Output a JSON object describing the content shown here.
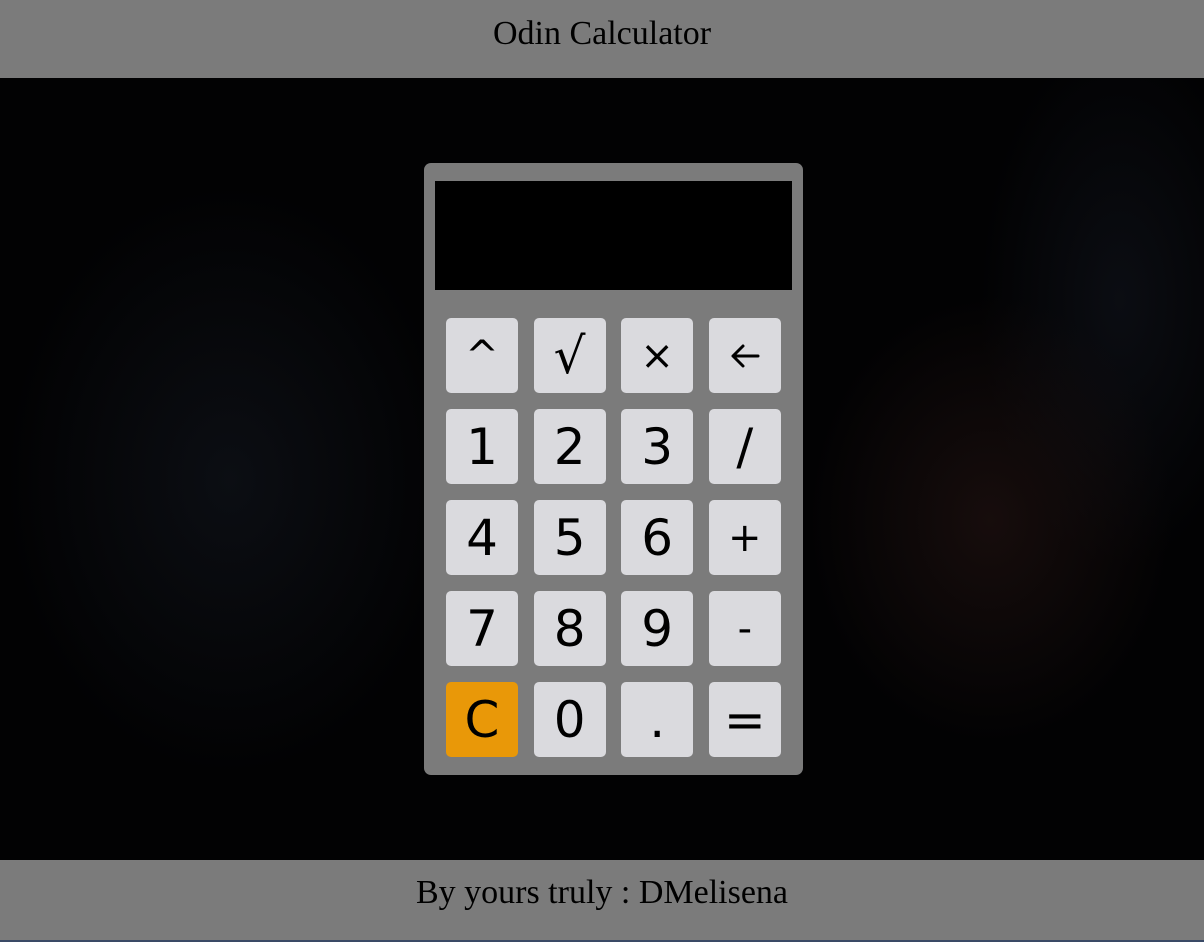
{
  "header": {
    "title": "Odin Calculator"
  },
  "display": {
    "value": ""
  },
  "keypad": {
    "keys": [
      {
        "label": "^",
        "name": "power-button"
      },
      {
        "label": "√",
        "name": "square-root-button"
      },
      {
        "label": "×",
        "name": "multiply-button"
      },
      {
        "label": "🡐",
        "name": "backspace-button"
      },
      {
        "label": "1",
        "name": "digit-1-button"
      },
      {
        "label": "2",
        "name": "digit-2-button"
      },
      {
        "label": "3",
        "name": "digit-3-button"
      },
      {
        "label": "/",
        "name": "divide-button"
      },
      {
        "label": "4",
        "name": "digit-4-button"
      },
      {
        "label": "5",
        "name": "digit-5-button"
      },
      {
        "label": "6",
        "name": "digit-6-button"
      },
      {
        "label": "+",
        "name": "add-button"
      },
      {
        "label": "7",
        "name": "digit-7-button"
      },
      {
        "label": "8",
        "name": "digit-8-button"
      },
      {
        "label": "9",
        "name": "digit-9-button"
      },
      {
        "label": "-",
        "name": "subtract-button"
      },
      {
        "label": "C",
        "name": "clear-button"
      },
      {
        "label": "0",
        "name": "digit-0-button"
      },
      {
        "label": ".",
        "name": "decimal-point-button"
      },
      {
        "label": "=",
        "name": "equals-button"
      }
    ]
  },
  "footer": {
    "text": "By yours truly : DMelisena"
  },
  "colors": {
    "bar_background": "#7b7b7b",
    "key_background": "#dadade",
    "clear_key": "#e99808",
    "display_background": "#000000"
  }
}
